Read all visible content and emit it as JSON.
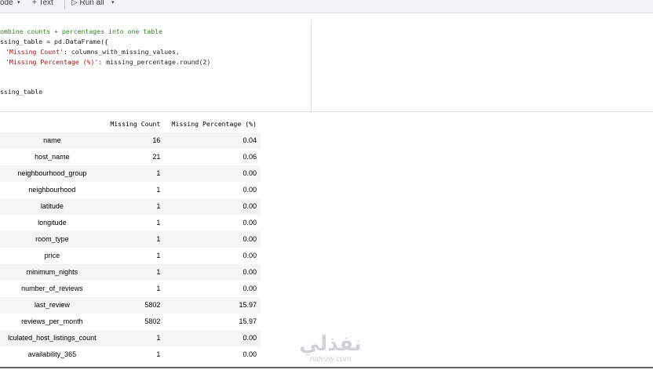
{
  "toolbar": {
    "code_label": "ode",
    "code_caret": "▾",
    "text_label": "+ Text",
    "run_all_label": "▷ Run all",
    "run_caret": "▾"
  },
  "code": {
    "line1": "ombine counts + percentages into one table",
    "line2_a": "ssing_table = pd.DataFrame({",
    "line3_str": "'Missing Count'",
    "line3_rest": ": columns_with_missing_values,",
    "line4_str": "'Missing Percentage (%)'",
    "line4_rest": ": missing_percentage.round(2)",
    "line5": "ssing_table"
  },
  "table": {
    "headers": [
      "Missing Count",
      "Missing Percentage (%)"
    ],
    "rows": [
      {
        "name": "name",
        "count": "16",
        "pct": "0.04"
      },
      {
        "name": "host_name",
        "count": "21",
        "pct": "0.06"
      },
      {
        "name": "neighbourhood_group",
        "count": "1",
        "pct": "0.00"
      },
      {
        "name": "neighbourhood",
        "count": "1",
        "pct": "0.00"
      },
      {
        "name": "latitude",
        "count": "1",
        "pct": "0.00"
      },
      {
        "name": "longitude",
        "count": "1",
        "pct": "0.00"
      },
      {
        "name": "room_type",
        "count": "1",
        "pct": "0.00"
      },
      {
        "name": "price",
        "count": "1",
        "pct": "0.00"
      },
      {
        "name": "minimum_nights",
        "count": "1",
        "pct": "0.00"
      },
      {
        "name": "number_of_reviews",
        "count": "1",
        "pct": "0.00"
      },
      {
        "name": "last_review",
        "count": "5802",
        "pct": "15.97"
      },
      {
        "name": "reviews_per_month",
        "count": "5802",
        "pct": "15.97"
      },
      {
        "name": "lculated_host_listings_count",
        "count": "1",
        "pct": "0.00"
      },
      {
        "name": "availability_365",
        "count": "1",
        "pct": "0.00"
      }
    ]
  },
  "watermark": {
    "arabic": "نفذلي",
    "latin": "nafezly.com"
  }
}
